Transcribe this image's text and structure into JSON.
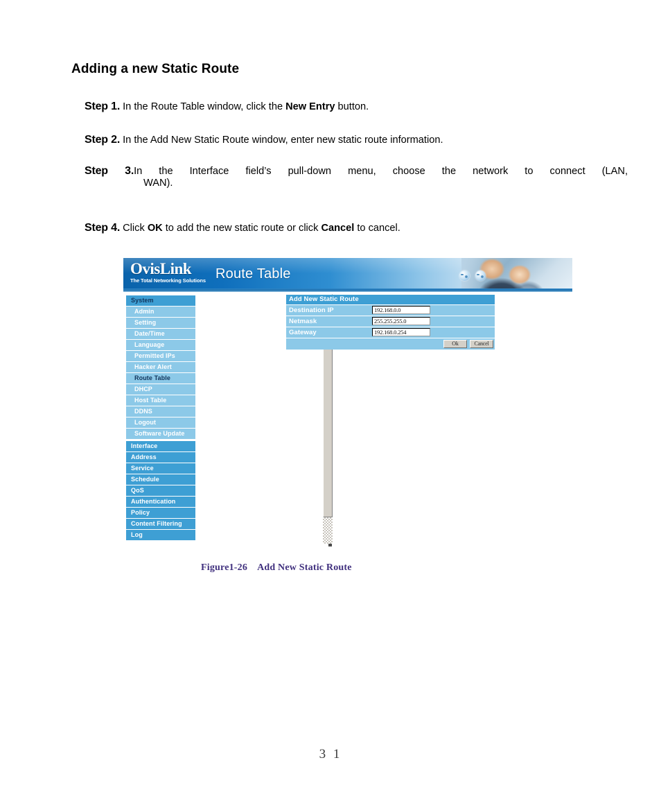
{
  "document": {
    "title": "Adding a new Static Route",
    "steps": [
      {
        "label": "Step 1.",
        "parts": [
          {
            "text": "In the Route Table window, click the ",
            "bold": false
          },
          {
            "text": "New Entry",
            "bold": true
          },
          {
            "text": " button.",
            "bold": false
          }
        ],
        "plain": "In the Route Table window, click the New Entry button."
      },
      {
        "label": "Step 2.",
        "parts": [
          {
            "text": "In the Add New Static Route window, enter new static route information.",
            "bold": false
          }
        ],
        "plain": "In the Add New Static Route window, enter new static route information."
      },
      {
        "label": "Step 3.",
        "line1": "In the Interface field’s pull-down menu, choose the network to connect (LAN,",
        "line2": "WAN).",
        "plain": "In the Interface field’s pull-down menu, choose the network to connect (LAN, WAN)."
      },
      {
        "label": "Step 4.",
        "parts": [
          {
            "text": "Click ",
            "bold": false
          },
          {
            "text": "OK",
            "bold": true
          },
          {
            "text": " to add the new static route or click ",
            "bold": false
          },
          {
            "text": "Cancel",
            "bold": true
          },
          {
            "text": " to cancel.",
            "bold": false
          }
        ],
        "plain": "Click OK to add the new static route or click Cancel to cancel."
      }
    ],
    "figure_caption": {
      "number": "Figure1-26",
      "title": "Add New Static Route"
    },
    "page_number": "3 1"
  },
  "screenshot": {
    "header": {
      "logo_name": "OvisLink",
      "logo_tagline": "The Total Networking Solutions",
      "page_heading": "Route Table",
      "icons": [
        "globe-icon",
        "globe-icon"
      ]
    },
    "sidebar": {
      "groups": [
        {
          "type": "group-head",
          "label": "System",
          "selected": false,
          "items": [
            {
              "label": "Admin",
              "selected": false
            },
            {
              "label": "Setting",
              "selected": false
            },
            {
              "label": "Date/Time",
              "selected": false
            },
            {
              "label": "Language",
              "selected": false
            },
            {
              "label": "Permitted IPs",
              "selected": false
            },
            {
              "label": "Hacker Alert",
              "selected": false
            },
            {
              "label": "Route Table",
              "selected": true
            },
            {
              "label": "DHCP",
              "selected": false
            },
            {
              "label": "Host Table",
              "selected": false
            },
            {
              "label": "DDNS",
              "selected": false
            },
            {
              "label": "Logout",
              "selected": false
            },
            {
              "label": "Software Update",
              "selected": false
            }
          ]
        }
      ],
      "main_items": [
        {
          "label": "Interface"
        },
        {
          "label": "Address"
        },
        {
          "label": "Service"
        },
        {
          "label": "Schedule"
        },
        {
          "label": "QoS"
        },
        {
          "label": "Authentication"
        },
        {
          "label": "Policy"
        },
        {
          "label": "Content Filtering"
        },
        {
          "label": "Log"
        }
      ]
    },
    "panel": {
      "title": "Add New Static Route",
      "fields": [
        {
          "label": "Destination IP",
          "value": "192.168.0.0"
        },
        {
          "label": "Netmask",
          "value": "255.255.255.0"
        },
        {
          "label": "Gateway",
          "value": "192.168.0.254"
        }
      ],
      "buttons": [
        {
          "label": "Ok"
        },
        {
          "label": "Cancel"
        }
      ]
    },
    "scrollbar": {
      "up_arrow": "triangle-up-icon"
    }
  },
  "colors": {
    "header_blue": "#0f6fbc",
    "nav_head_blue": "#3e9fd4",
    "nav_item_blue": "#8cc9e8",
    "nav_selected_text": "#12355c",
    "caption_purple": "#40307e"
  }
}
